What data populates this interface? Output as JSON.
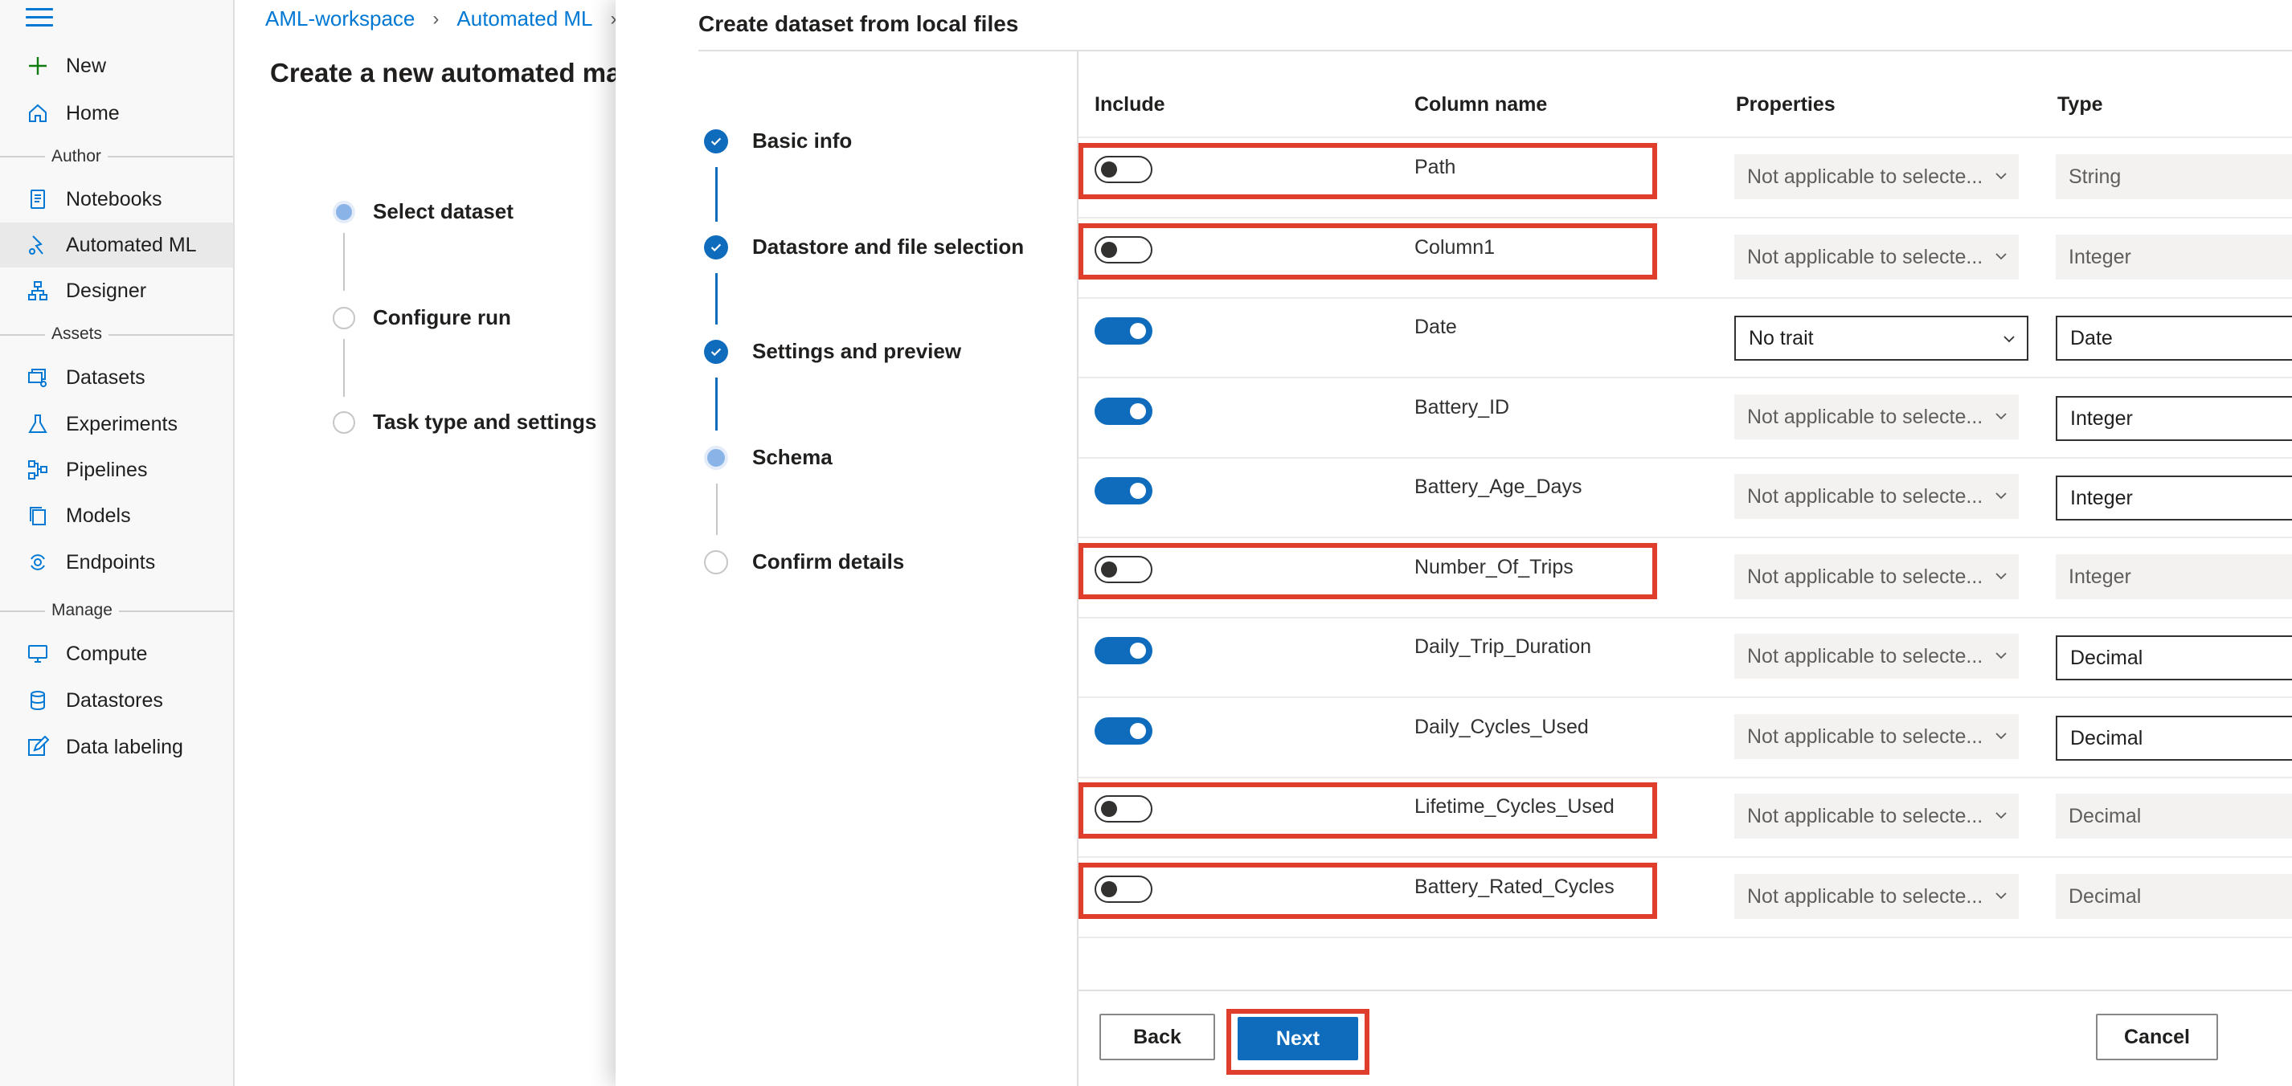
{
  "nav": {
    "items": [
      {
        "id": "new",
        "label": "New",
        "icon": "plus-icon"
      },
      {
        "id": "home",
        "label": "Home",
        "icon": "home-icon"
      },
      {
        "id": "notebooks",
        "label": "Notebooks",
        "icon": "notebook-icon"
      },
      {
        "id": "automated-ml",
        "label": "Automated ML",
        "icon": "automl-icon"
      },
      {
        "id": "designer",
        "label": "Designer",
        "icon": "designer-icon"
      },
      {
        "id": "datasets",
        "label": "Datasets",
        "icon": "datasets-icon"
      },
      {
        "id": "experiments",
        "label": "Experiments",
        "icon": "flask-icon"
      },
      {
        "id": "pipelines",
        "label": "Pipelines",
        "icon": "pipeline-icon"
      },
      {
        "id": "models",
        "label": "Models",
        "icon": "models-icon"
      },
      {
        "id": "endpoints",
        "label": "Endpoints",
        "icon": "endpoints-icon"
      },
      {
        "id": "compute",
        "label": "Compute",
        "icon": "compute-icon"
      },
      {
        "id": "datastores",
        "label": "Datastores",
        "icon": "database-icon"
      },
      {
        "id": "data-labeling",
        "label": "Data labeling",
        "icon": "edit-icon"
      }
    ],
    "sections": {
      "author": "Author",
      "assets": "Assets",
      "manage": "Manage"
    },
    "selected": "Automated ML"
  },
  "breadcrumb": {
    "workspace": "AML-workspace",
    "page": "Automated ML"
  },
  "page": {
    "title": "Create a new automated mac",
    "steps": [
      "Select dataset",
      "Configure run",
      "Task type and settings"
    ]
  },
  "panel": {
    "title": "Create dataset from local files",
    "steps": [
      {
        "label": "Basic info",
        "state": "done"
      },
      {
        "label": "Datastore and file selection",
        "state": "done"
      },
      {
        "label": "Settings and preview",
        "state": "done"
      },
      {
        "label": "Schema",
        "state": "current"
      },
      {
        "label": "Confirm details",
        "state": "todo"
      }
    ],
    "table": {
      "headers": {
        "include": "Include",
        "column_name": "Column name",
        "properties": "Properties",
        "type": "Type"
      },
      "rows": [
        {
          "include": false,
          "name": "Path",
          "property": "Not applicable to selecte...",
          "type": "String",
          "highlighted": true
        },
        {
          "include": false,
          "name": "Column1",
          "property": "Not applicable to selecte...",
          "type": "Integer",
          "highlighted": true
        },
        {
          "include": true,
          "name": "Date",
          "property": "No trait",
          "property_enabled": true,
          "type": "Date",
          "highlighted": false
        },
        {
          "include": true,
          "name": "Battery_ID",
          "property": "Not applicable to selecte...",
          "type": "Integer",
          "highlighted": false
        },
        {
          "include": true,
          "name": "Battery_Age_Days",
          "property": "Not applicable to selecte...",
          "type": "Integer",
          "highlighted": false
        },
        {
          "include": false,
          "name": "Number_Of_Trips",
          "property": "Not applicable to selecte...",
          "type": "Integer",
          "highlighted": true
        },
        {
          "include": true,
          "name": "Daily_Trip_Duration",
          "property": "Not applicable to selecte...",
          "type": "Decimal",
          "highlighted": false
        },
        {
          "include": true,
          "name": "Daily_Cycles_Used",
          "property": "Not applicable to selecte...",
          "type": "Decimal",
          "highlighted": false
        },
        {
          "include": false,
          "name": "Lifetime_Cycles_Used",
          "property": "Not applicable to selecte...",
          "type": "Decimal",
          "highlighted": true
        },
        {
          "include": false,
          "name": "Battery_Rated_Cycles",
          "property": "Not applicable to selecte...",
          "type": "Decimal",
          "highlighted": true
        }
      ]
    },
    "footer": {
      "back": "Back",
      "next": "Next",
      "cancel": "Cancel"
    }
  },
  "colors": {
    "accent": "#0f6cbd",
    "highlight": "#e03e2d",
    "link": "#0078d4"
  }
}
